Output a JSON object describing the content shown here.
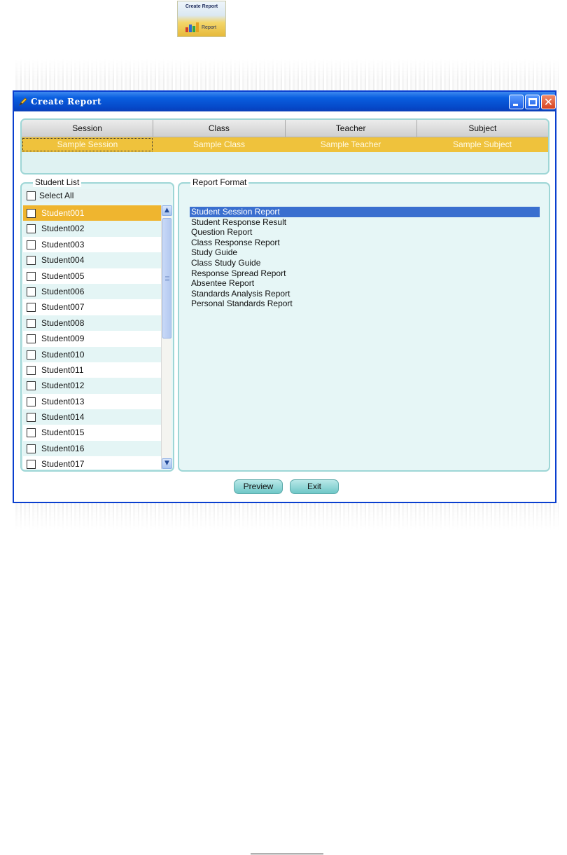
{
  "toolbar_icon": {
    "title": "Create Report",
    "label": "Report",
    "icon": "report-chart-icon"
  },
  "window": {
    "title": "Create Report",
    "controls": {
      "minimize": "_",
      "maximize": "",
      "close": "✕"
    }
  },
  "header": {
    "columns": [
      "Session",
      "Class",
      "Teacher",
      "Subject"
    ],
    "values": [
      "Sample Session",
      "Sample Class",
      "Sample Teacher",
      "Sample Subject"
    ]
  },
  "student_list": {
    "legend": "Student List",
    "select_all": "Select All",
    "selected_index": 0,
    "students": [
      "Student001",
      "Student002",
      "Student003",
      "Student004",
      "Student005",
      "Student006",
      "Student007",
      "Student008",
      "Student009",
      "Student010",
      "Student011",
      "Student012",
      "Student013",
      "Student014",
      "Student015",
      "Student016",
      "Student017"
    ]
  },
  "report_format": {
    "legend": "Report Format",
    "selected_index": 0,
    "items": [
      "Student Session Report",
      "Student Response Result",
      "Question Report",
      "Class Response Report",
      "Study Guide",
      "Class Study Guide",
      "Response Spread Report",
      "Absentee Report",
      "Standards Analysis Report",
      "Personal Standards Report"
    ]
  },
  "buttons": {
    "preview": "Preview",
    "exit": "Exit"
  },
  "colors": {
    "accent_yellow": "#efc23c",
    "selection_blue": "#3a6fcf",
    "panel_teal": "#9ed6d6",
    "titlebar_blue": "#0548c8"
  }
}
